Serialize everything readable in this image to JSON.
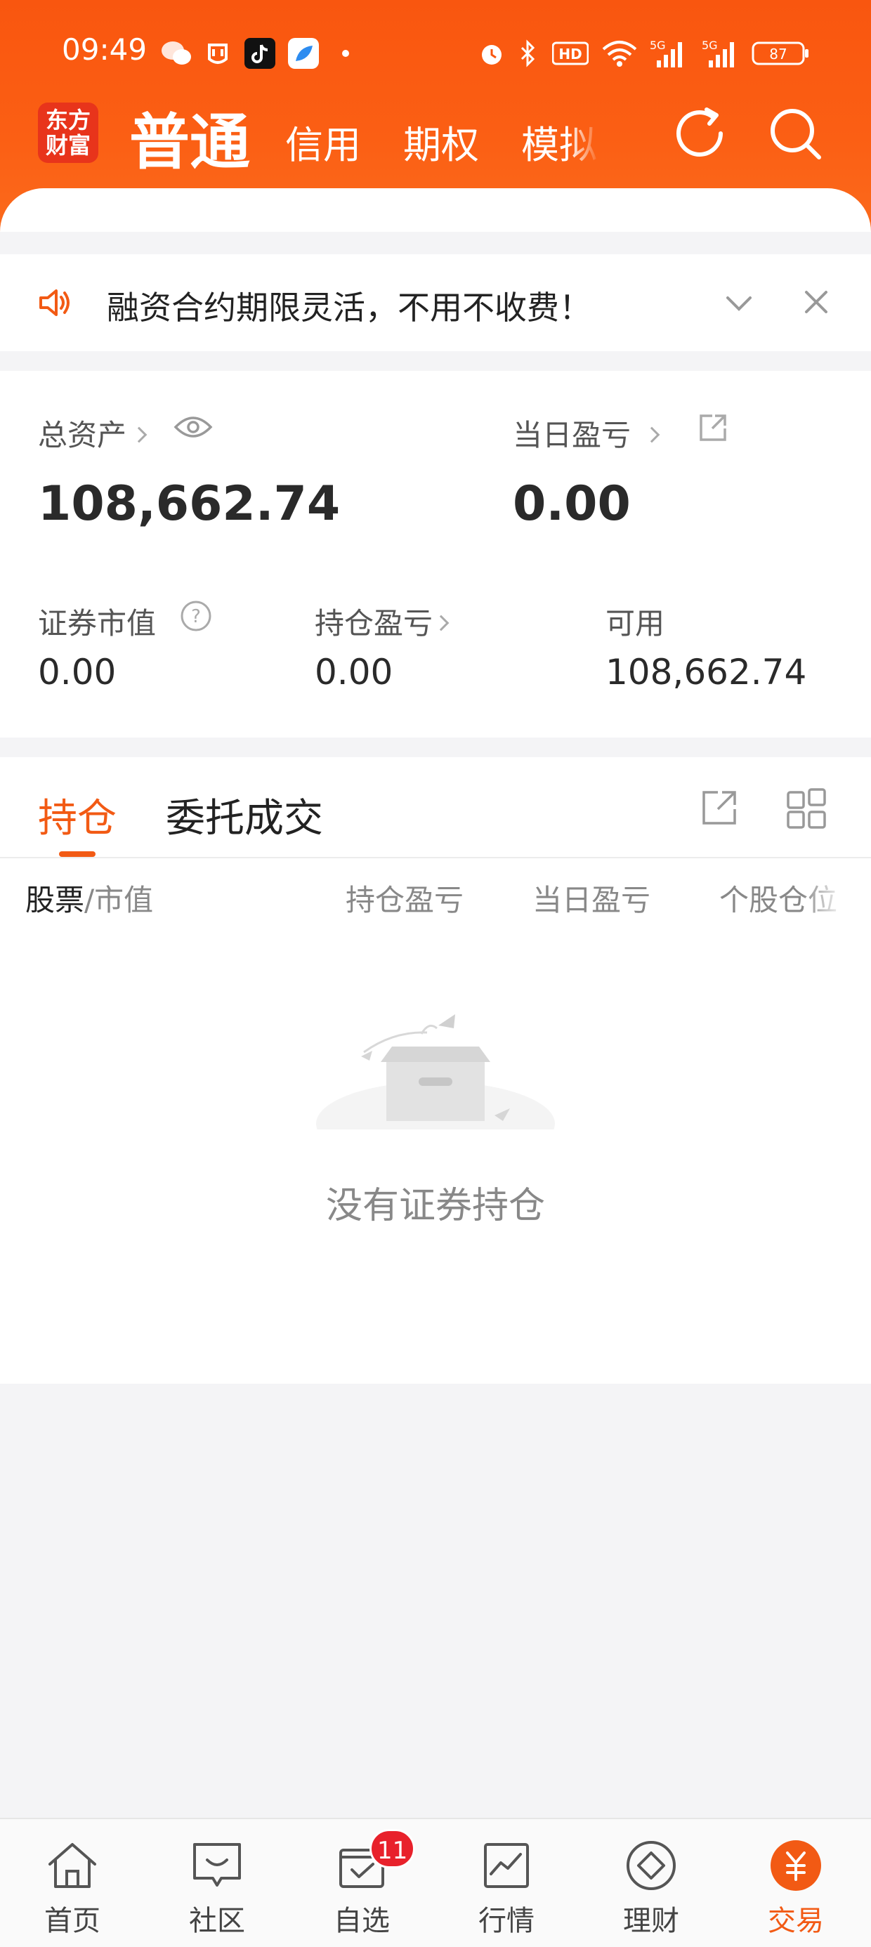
{
  "status_bar": {
    "time": "09:49",
    "battery": "87",
    "network": "5G",
    "hd": "HD"
  },
  "header": {
    "logo_line1": "东方",
    "logo_line2": "财富",
    "tabs": [
      {
        "label": "普通",
        "active": true
      },
      {
        "label": "信用",
        "active": false
      },
      {
        "label": "期权",
        "active": false
      },
      {
        "label": "模拟",
        "active": false
      }
    ]
  },
  "notice": {
    "text": "融资合约期限灵活，不用不收费！"
  },
  "assets": {
    "total_label": "总资产",
    "total_value": "108,662.74",
    "daily_pl_label": "当日盈亏",
    "daily_pl_value": "0.00",
    "market_value_label": "证券市值",
    "market_value": "0.00",
    "position_pl_label": "持仓盈亏",
    "position_pl_value": "0.00",
    "available_label": "可用",
    "available_value": "108,662.74"
  },
  "holdings": {
    "tabs": [
      {
        "label": "持仓",
        "active": true
      },
      {
        "label": "委托成交",
        "active": false
      }
    ],
    "columns": {
      "stock": "股票",
      "sep_market": "/市值",
      "position_pl": "持仓盈亏",
      "daily_pl": "当日盈亏",
      "position_pct": "个股仓位"
    },
    "empty_text": "没有证券持仓"
  },
  "bottom_nav": {
    "items": [
      {
        "label": "首页",
        "icon": "home-icon"
      },
      {
        "label": "社区",
        "icon": "chat-icon"
      },
      {
        "label": "自选",
        "icon": "watchlist-icon",
        "badge": "11"
      },
      {
        "label": "行情",
        "icon": "chart-icon"
      },
      {
        "label": "理财",
        "icon": "diamond-icon"
      },
      {
        "label": "交易",
        "icon": "trade-icon",
        "active": true
      }
    ]
  },
  "colors": {
    "brand": "#f9560f",
    "accent": "#f25a14",
    "badge": "#e8212b"
  }
}
